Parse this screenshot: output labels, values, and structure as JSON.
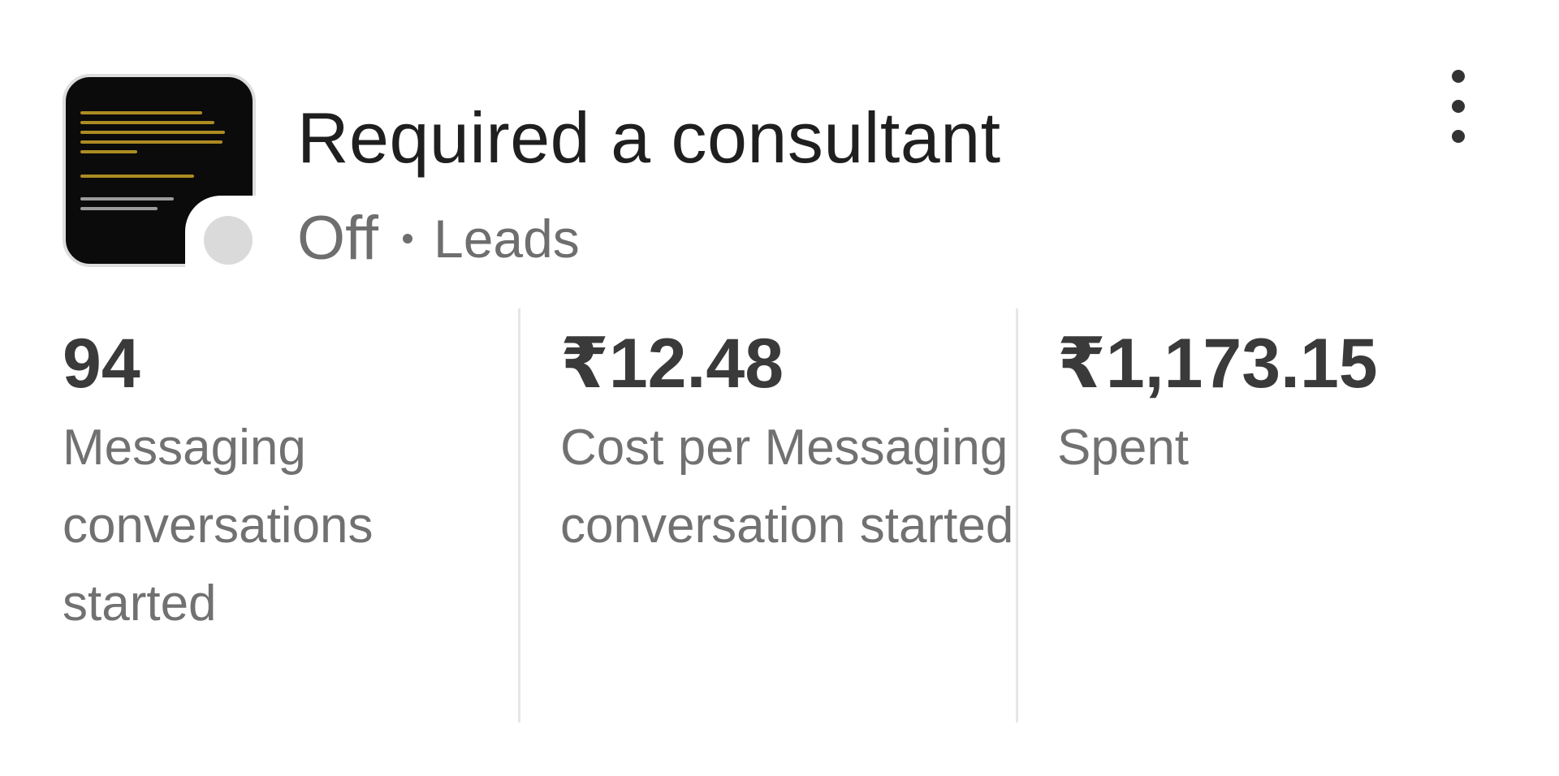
{
  "ad": {
    "title": "Required a consultant",
    "status": "Off",
    "objective": "Leads",
    "thumbnail_icon": "ad-creative-thumbnail",
    "status_color": "#dadada"
  },
  "menu": {
    "icon": "more-vert-icon"
  },
  "metrics": [
    {
      "value": "94",
      "label": "Messaging conversations started"
    },
    {
      "value": "₹12.48",
      "label": "Cost per Messaging conversation started"
    },
    {
      "value": "₹1,173.15",
      "label": "Spent"
    }
  ]
}
